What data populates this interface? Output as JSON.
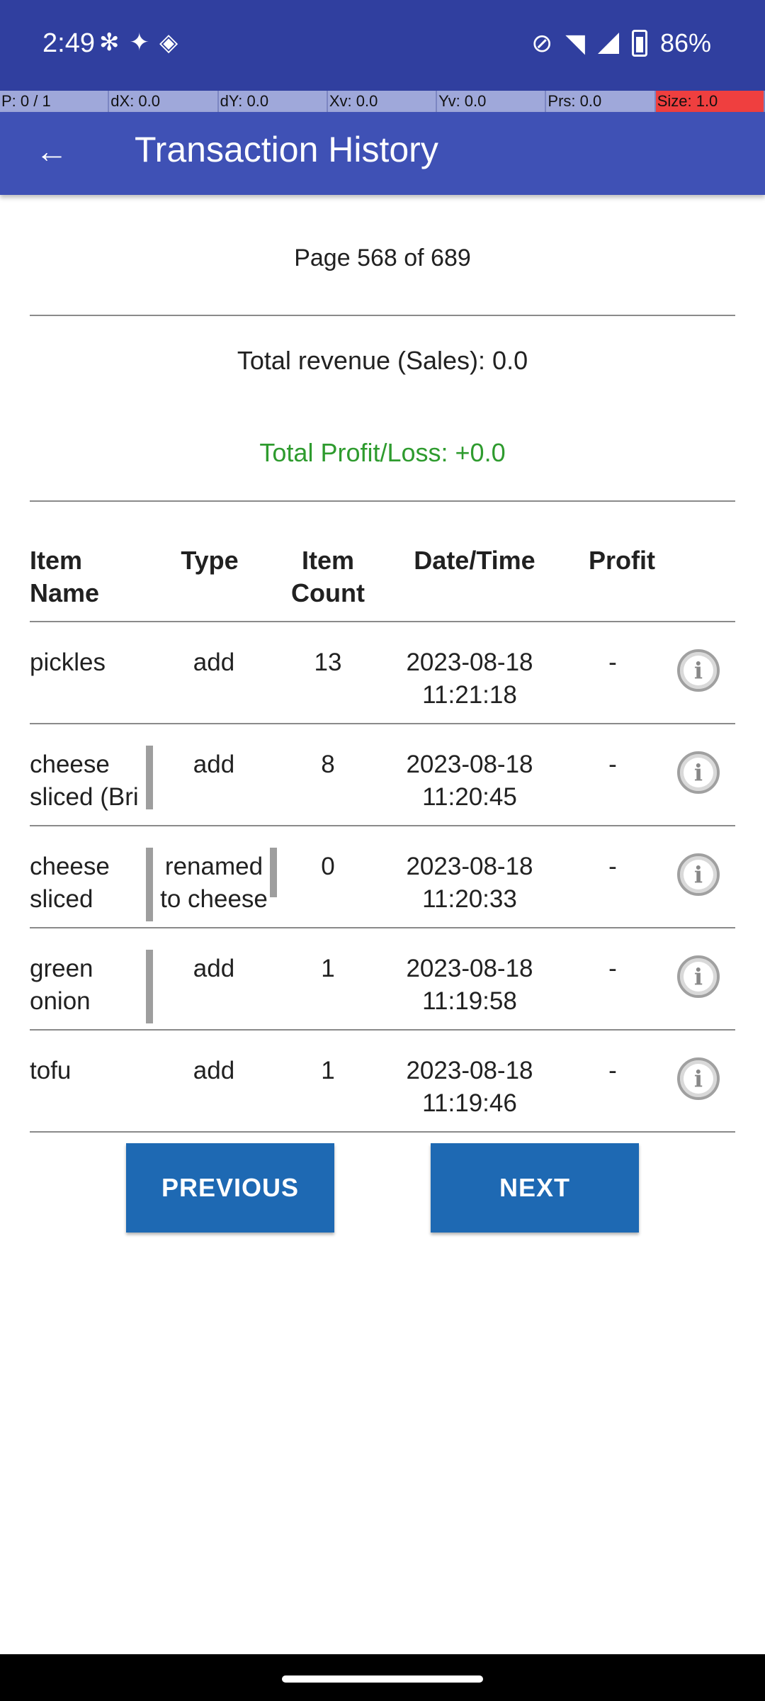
{
  "status_bar": {
    "time": "2:49",
    "battery": "86%",
    "left_icons": [
      "slack-icon",
      "sparkle-icon",
      "diamond-icon"
    ],
    "right_icons": [
      "vibrate-off-icon",
      "wifi-icon",
      "signal-icon",
      "battery-icon"
    ]
  },
  "pointer_location": [
    "P: 0 / 1",
    "dX: 0.0",
    "dY: 0.0",
    "Xv: 0.0",
    "Yv: 0.0",
    "Prs: 0.0",
    "Size: 1.0"
  ],
  "app_bar": {
    "title": "Transaction History",
    "back_icon": "arrow-back-icon"
  },
  "page_label": "Page 568 of 689",
  "revenue_label": "Total revenue (Sales): 0.0",
  "profit_label": "Total Profit/Loss: +0.0",
  "colors": {
    "status_bar": "#303f9f",
    "app_bar": "#3f51b5",
    "button": "#1e69b3",
    "profit_text": "#2e9b2e",
    "pointer_alert": "#ef3f3f"
  },
  "table": {
    "headers": {
      "name": "Item\nName",
      "type": "Type",
      "count": "Item\nCount",
      "date": "Date/Time",
      "profit": "Profit"
    },
    "rows": [
      {
        "name": "pickles",
        "type": "add",
        "count": "13",
        "date": "2023-08-18\n11:21:18",
        "profit": "-"
      },
      {
        "name": "cheese\nsliced (Bri",
        "type": "add",
        "count": "8",
        "date": "2023-08-18\n11:20:45",
        "profit": "-"
      },
      {
        "name": "cheese\nsliced",
        "type": "renamed\nto cheese",
        "count": "0",
        "date": "2023-08-18\n11:20:33",
        "profit": "-"
      },
      {
        "name": "green\nonion",
        "type": "add",
        "count": "1",
        "date": "2023-08-18\n11:19:58",
        "profit": "-"
      },
      {
        "name": "tofu",
        "type": "add",
        "count": "1",
        "date": "2023-08-18\n11:19:46",
        "profit": "-"
      }
    ]
  },
  "buttons": {
    "previous": "PREVIOUS",
    "next": "NEXT"
  }
}
